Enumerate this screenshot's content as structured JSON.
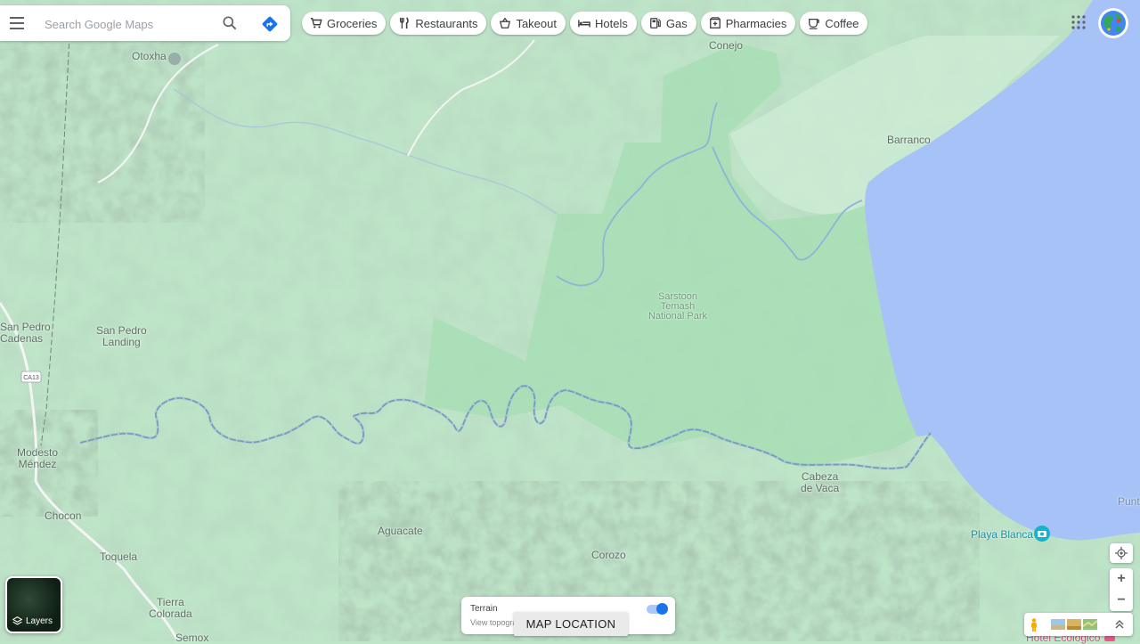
{
  "search": {
    "placeholder": "Search Google Maps"
  },
  "chips": [
    {
      "label": "Groceries",
      "icon": "cart-icon"
    },
    {
      "label": "Restaurants",
      "icon": "fork-knife-icon"
    },
    {
      "label": "Takeout",
      "icon": "takeout-bag-icon"
    },
    {
      "label": "Hotels",
      "icon": "bed-icon"
    },
    {
      "label": "Gas",
      "icon": "gas-pump-icon"
    },
    {
      "label": "Pharmacies",
      "icon": "pharmacy-icon"
    },
    {
      "label": "Coffee",
      "icon": "coffee-cup-icon"
    }
  ],
  "places": [
    {
      "id": "otoxha",
      "label": "Otoxha"
    },
    {
      "id": "conejo",
      "label": "Conejo"
    },
    {
      "id": "barranco",
      "label": "Barranco"
    },
    {
      "id": "park",
      "label": "Sarstoon\nTemash\nNational Park"
    },
    {
      "id": "san-pedro-cadenas",
      "label": "San Pedro\nCadenas"
    },
    {
      "id": "san-pedro-landing",
      "label": "San Pedro\nLanding"
    },
    {
      "id": "modesto-mendez",
      "label": "Modesto\nMéndez"
    },
    {
      "id": "chocon",
      "label": "Chocon"
    },
    {
      "id": "toquela",
      "label": "Toquela"
    },
    {
      "id": "tierra-colorada",
      "label": "Tierra\nColorada"
    },
    {
      "id": "semox",
      "label": "Semox"
    },
    {
      "id": "aguacate",
      "label": "Aguacate"
    },
    {
      "id": "corozo",
      "label": "Corozo"
    },
    {
      "id": "cabeza-de-vaca",
      "label": "Cabeza\nde Vaca"
    },
    {
      "id": "playa-blanca",
      "label": "Playa Blanca"
    },
    {
      "id": "hotel-ecologico",
      "label": "Hotel Ecologico"
    },
    {
      "id": "punta",
      "label": "Punt"
    }
  ],
  "road_shield": "CA13",
  "layers": {
    "label": "Layers"
  },
  "terrain": {
    "title": "Terrain",
    "subtitle": "View topography",
    "enabled": true
  },
  "overlay": {
    "map_location": "MAP LOCATION"
  },
  "colors": {
    "land": "#bfe5c9",
    "park": "#a6ddb3",
    "water": "#a7c2f6",
    "river": "#8fb3d9",
    "border": "#6b7fa8",
    "accent": "#1a73e8"
  }
}
